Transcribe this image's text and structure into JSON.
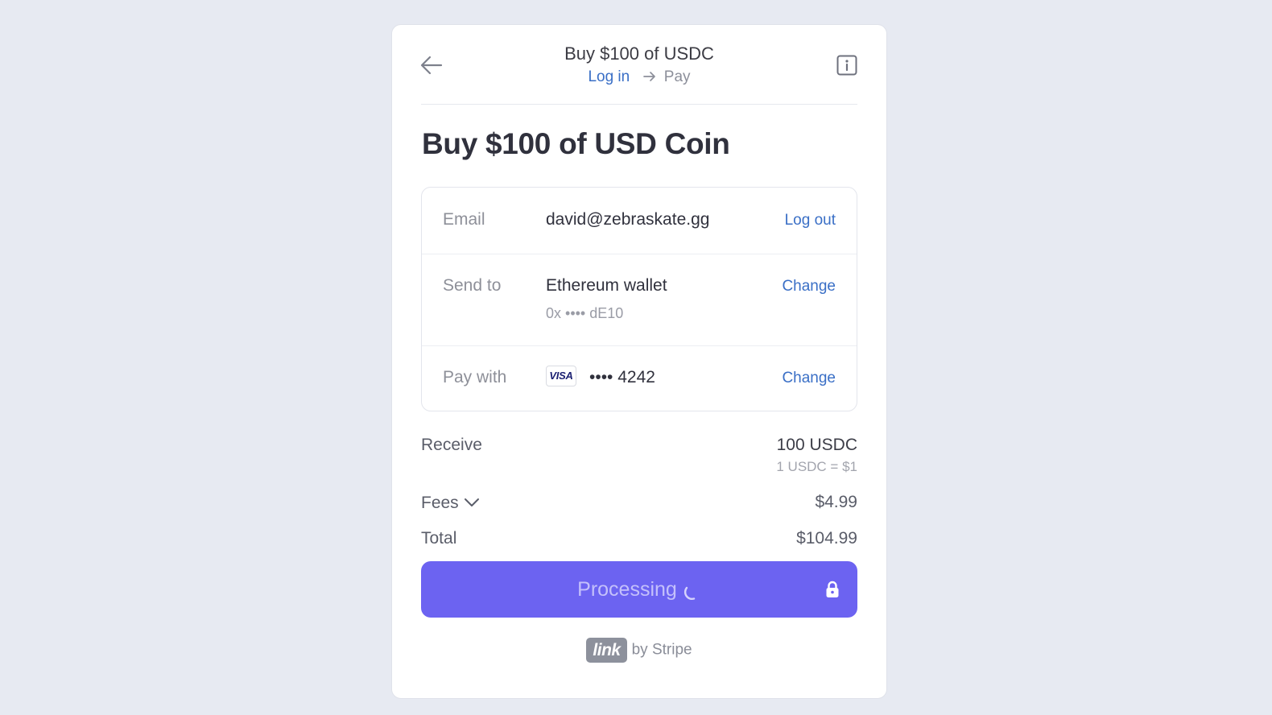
{
  "header": {
    "title": "Buy $100 of USDC",
    "breadcrumb": {
      "step1": "Log in",
      "step2": "Pay"
    },
    "back_icon": "arrow-left-icon",
    "info_icon": "info-icon"
  },
  "page_title": "Buy $100 of USD Coin",
  "details": {
    "email": {
      "label": "Email",
      "value": "david@zebraskate.gg",
      "action": "Log out"
    },
    "send_to": {
      "label": "Send to",
      "value": "Ethereum wallet",
      "sub": "0x •••• dE10",
      "action": "Change"
    },
    "pay_with": {
      "label": "Pay with",
      "card_brand": "VISA",
      "card_number": "•••• 4242",
      "action": "Change"
    }
  },
  "summary": {
    "receive": {
      "label": "Receive",
      "value": "100 USDC",
      "rate": "1 USDC = $1"
    },
    "fees": {
      "label": "Fees",
      "value": "$4.99"
    },
    "total": {
      "label": "Total",
      "value": "$104.99"
    }
  },
  "pay_button": {
    "label": "Processing",
    "state": "processing",
    "color": "#6c63f1"
  },
  "footer": {
    "logo_text": "link",
    "by_text": "by Stripe"
  },
  "colors": {
    "background": "#e7eaf2",
    "link": "#3a6fc6",
    "accent": "#6c63f1"
  }
}
